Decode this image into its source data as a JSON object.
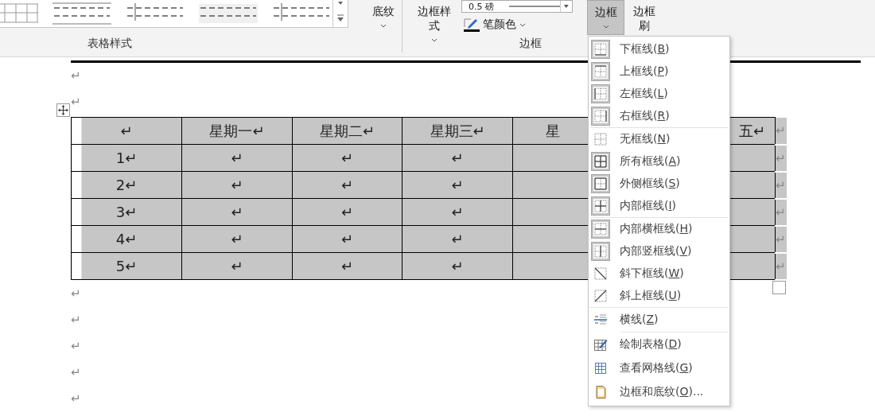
{
  "ribbon": {
    "table_styles": {
      "label": "表格样式"
    },
    "shading_button": {
      "label": "底纹"
    },
    "borders_group": {
      "label": "边框",
      "border_styles_button": "边框样式",
      "line_weight": "0.5 磅",
      "pen_color_button": "笔颜色",
      "borders_button": {
        "label": "边框",
        "selected": true
      },
      "border_painter_button": "边框刷"
    }
  },
  "document": {
    "marks_before": [
      "↵",
      "↵"
    ],
    "table": {
      "header": [
        "↵",
        "星期一↵",
        "星期二↵",
        "星期三↵",
        "星",
        "五↵"
      ],
      "rows": [
        {
          "cells": [
            "1↵",
            "↵",
            "↵",
            "↵"
          ],
          "end_mark": "↵"
        },
        {
          "cells": [
            "2↵",
            "↵",
            "↵",
            "↵"
          ],
          "end_mark": "↵"
        },
        {
          "cells": [
            "3↵",
            "↵",
            "↵",
            "↵"
          ],
          "end_mark": "↵"
        },
        {
          "cells": [
            "4↵",
            "↵",
            "↵",
            "↵"
          ],
          "end_mark": "↵"
        },
        {
          "cells": [
            "5↵",
            "↵",
            "↵",
            "↵"
          ],
          "end_mark": "↵"
        }
      ],
      "header_end_mark": "↵"
    },
    "marks_after": [
      "↵",
      "↵",
      "↵",
      "↵",
      "↵"
    ]
  },
  "borders_menu": {
    "groups": [
      [
        {
          "label": "下框线(",
          "key": "B",
          "after": ")",
          "kind": "bottom",
          "checked": true
        },
        {
          "label": "上框线(",
          "key": "P",
          "after": ")",
          "kind": "top",
          "checked": true
        },
        {
          "label": "左框线(",
          "key": "L",
          "after": ")",
          "kind": "left",
          "checked": true
        },
        {
          "label": "右框线(",
          "key": "R",
          "after": ")",
          "kind": "right",
          "checked": true
        }
      ],
      [
        {
          "label": "无框线(",
          "key": "N",
          "after": ")",
          "kind": "none",
          "checked": false
        },
        {
          "label": "所有框线(",
          "key": "A",
          "after": ")",
          "kind": "all",
          "checked": true
        },
        {
          "label": "外侧框线(",
          "key": "S",
          "after": ")",
          "kind": "outside",
          "checked": true
        },
        {
          "label": "内部框线(",
          "key": "I",
          "after": ")",
          "kind": "inside",
          "checked": true
        }
      ],
      [
        {
          "label": "内部横框线(",
          "key": "H",
          "after": ")",
          "kind": "inside_h",
          "checked": true
        },
        {
          "label": "内部竖框线(",
          "key": "V",
          "after": ")",
          "kind": "inside_v",
          "checked": true
        },
        {
          "label": "斜下框线(",
          "key": "W",
          "after": ")",
          "kind": "diag_down",
          "checked": false
        },
        {
          "label": "斜上框线(",
          "key": "U",
          "after": ")",
          "kind": "diag_up",
          "checked": false
        }
      ],
      [
        {
          "label": "横线(",
          "key": "Z",
          "after": ")",
          "kind": "horizontal_line"
        }
      ],
      [
        {
          "label": "绘制表格(",
          "key": "D",
          "after": ")",
          "kind": "draw_table"
        },
        {
          "label": "查看网格线(",
          "key": "G",
          "after": ")",
          "kind": "gridlines"
        },
        {
          "label": "边框和底纹(",
          "key": "O",
          "after": ")...",
          "kind": "borders_shading"
        }
      ]
    ]
  }
}
